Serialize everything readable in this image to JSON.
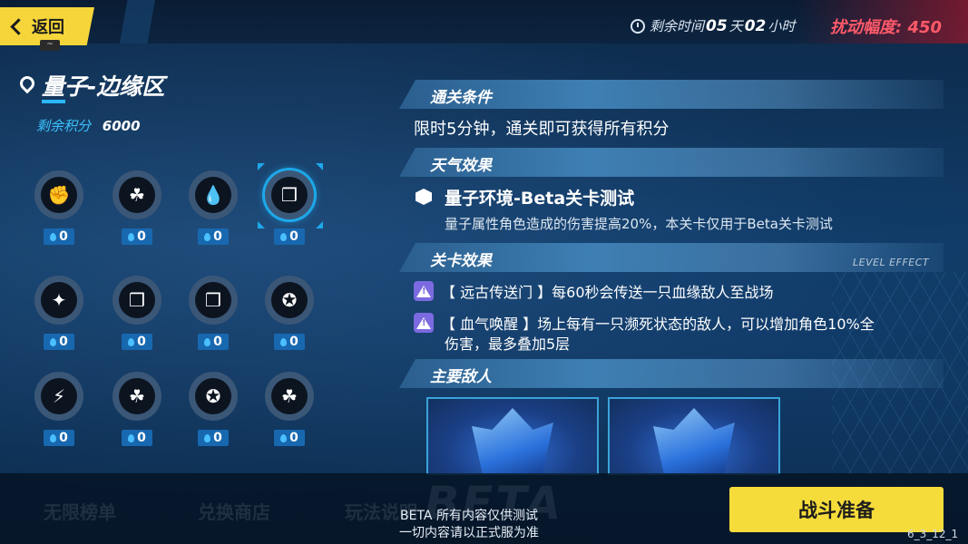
{
  "topbar": {
    "back_label": "返回",
    "back_sub": "~",
    "time_label": "剩余时间",
    "days": "05",
    "days_unit": "天",
    "hours": "02",
    "hours_unit": "小时",
    "disturb": "扰动幅度: 450"
  },
  "left": {
    "location": "量子-边缘区",
    "score_label": "剩余积分",
    "score_value": "6000",
    "grid": [
      {
        "icon": "fist-icon",
        "glyph": "✊",
        "cost": "0"
      },
      {
        "icon": "triskelion-icon",
        "glyph": "☘",
        "cost": "0"
      },
      {
        "icon": "droplet-icon",
        "glyph": "💧",
        "cost": "0"
      },
      {
        "icon": "quantum-cube-icon",
        "glyph": "❒",
        "cost": "0",
        "selected": true
      },
      {
        "icon": "fire-head-icon",
        "glyph": "✦",
        "cost": "0"
      },
      {
        "icon": "quantum-cube-icon",
        "glyph": "❒",
        "cost": "0"
      },
      {
        "icon": "quantum-cube-icon",
        "glyph": "❒",
        "cost": "0"
      },
      {
        "icon": "lightning-ring-icon",
        "glyph": "✪",
        "cost": "0"
      },
      {
        "icon": "lightning-icon",
        "glyph": "⚡",
        "cost": "0"
      },
      {
        "icon": "triskelion-icon",
        "glyph": "☘",
        "cost": "0"
      },
      {
        "icon": "lightning-ring-icon",
        "glyph": "✪",
        "cost": "0"
      },
      {
        "icon": "triskelion-icon",
        "glyph": "☘",
        "cost": "0"
      }
    ]
  },
  "right": {
    "clear_title": "通关条件",
    "clear_text": "限时5分钟，通关即可获得所有积分",
    "weather_title": "天气效果",
    "weather_name": "量子环境-Beta关卡测试",
    "weather_desc": "量子属性角色造成的伤害提高20%，本关卡仅用于Beta关卡测试",
    "stage_title": "关卡效果",
    "stage_tag": "LEVEL EFFECT",
    "effect1": "【 远古传送门 】每60秒会传送一只血缘敌人至战场",
    "effect2_line1": "【 血气唤醒 】场上每有一只濒死状态的敌人，可以增加角色10%全",
    "effect2_line2": "伤害，最多叠加5层",
    "enemy_title": "主要敌人"
  },
  "bottom": {
    "tab1": "无限榜单",
    "tab2": "兑换商店",
    "tab3": "玩法说明",
    "beta_bg": "BETA",
    "beta_line1": "BETA 所有内容仅供测试",
    "beta_line2": "一切内容请以正式服为准",
    "battle": "战斗准备",
    "version": "6_3_12_1"
  }
}
